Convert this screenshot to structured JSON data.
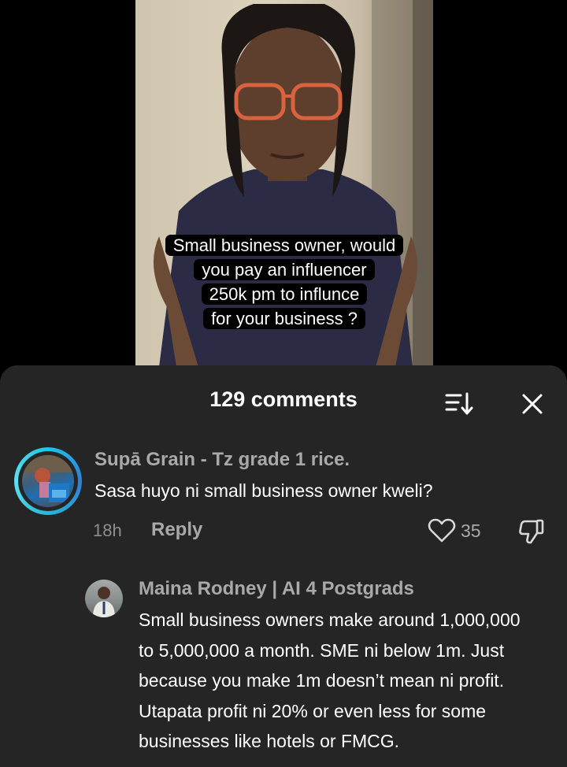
{
  "video": {
    "caption_lines": [
      "Small business owner, would",
      "you pay an influencer",
      "250k pm to influnce",
      "for your business ?"
    ]
  },
  "comments_sheet": {
    "title": "129 comments",
    "sort_icon": "sort-icon",
    "close_icon": "close-icon"
  },
  "comments": [
    {
      "author": "Supā Grain - Tz grade 1 rice.",
      "text": "Sasa huyo ni small business owner kweli?",
      "time": "18h",
      "reply_label": "Reply",
      "likes": "35",
      "avatar_ring_color": "#20c4e6"
    }
  ],
  "replies": [
    {
      "author": "Maina Rodney | AI 4 Postgrads",
      "text_lines": [
        "Small business owners make around 1,000,000",
        "to 5,000,000 a month. SME ni below 1m. Just",
        "because you make 1m doesn’t mean ni profit.",
        "Utapata profit ni 20% or even less for some",
        "businesses like hotels or FMCG."
      ]
    }
  ],
  "colors": {
    "sheet_background": "#252525",
    "secondary_text": "#a9a9a9",
    "primary_text": "#ffffff"
  }
}
